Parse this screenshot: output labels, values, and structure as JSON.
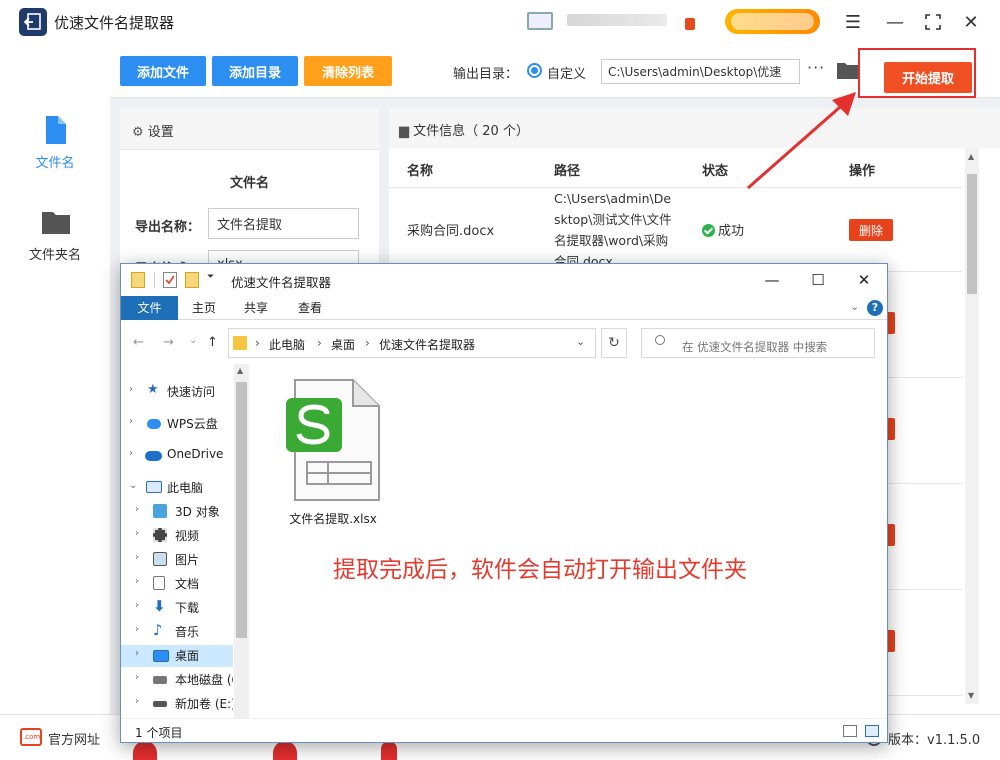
{
  "app": {
    "title": "优速文件名提取器",
    "menu_icon": "hamburger-icon",
    "minimize_icon": "minimize-icon",
    "maximize_icon": "maximize-icon",
    "close_icon": "close-icon"
  },
  "leftnav": {
    "items": [
      {
        "label": "文件名",
        "icon": "file-icon",
        "active": true
      },
      {
        "label": "文件夹名",
        "icon": "folder-icon",
        "active": false
      }
    ]
  },
  "toolbar": {
    "add_file": "添加文件",
    "add_dir": "添加目录",
    "clear_list": "清除列表",
    "output_label": "输出目录：",
    "custom_option": "自定义",
    "output_path": "C:\\Users\\admin\\Desktop\\优速",
    "more": "···",
    "start": "开始提取"
  },
  "settings": {
    "header": "设置",
    "section": "文件名",
    "export_name_label": "导出名称：",
    "export_name_value": "文件名提取",
    "export_format_label": "导出格式：",
    "export_format_value": "xlsx"
  },
  "fileinfo": {
    "header": "文件信息（ 20 个）",
    "columns": [
      "名称",
      "路径",
      "状态",
      "操作"
    ],
    "rows": [
      {
        "name": "采购合同.docx",
        "path": "C:\\Users\\admin\\Desktop\\测试文件\\文件名提取器\\word\\采购合同.docx",
        "status": "成功",
        "action": "删除"
      }
    ]
  },
  "bottombar": {
    "website": "官方网址",
    "website_icon_text": ".com",
    "version": "版本：v1.1.5.0"
  },
  "explorer": {
    "title": "优速文件名提取器",
    "ribbon_tabs": [
      "文件",
      "主页",
      "共享",
      "查看"
    ],
    "breadcrumb": [
      "此电脑",
      "桌面",
      "优速文件名提取器"
    ],
    "search_placeholder": "在 优速文件名提取器 中搜索",
    "tree": [
      {
        "label": "快速访问",
        "icon": "star-icon",
        "level": 0,
        "expander": "›"
      },
      {
        "label": "WPS云盘",
        "icon": "cloud-icon",
        "level": 0,
        "expander": "›"
      },
      {
        "label": "OneDrive",
        "icon": "onedrive-icon",
        "level": 0,
        "expander": "›"
      },
      {
        "label": "此电脑",
        "icon": "pc-icon",
        "level": 0,
        "expander": "⌄"
      },
      {
        "label": "3D 对象",
        "icon": "cube-icon",
        "level": 1,
        "expander": "›"
      },
      {
        "label": "视频",
        "icon": "video-icon",
        "level": 1,
        "expander": "›"
      },
      {
        "label": "图片",
        "icon": "picture-icon",
        "level": 1,
        "expander": "›"
      },
      {
        "label": "文档",
        "icon": "document-icon",
        "level": 1,
        "expander": "›"
      },
      {
        "label": "下载",
        "icon": "download-icon",
        "level": 1,
        "expander": "›"
      },
      {
        "label": "音乐",
        "icon": "music-icon",
        "level": 1,
        "expander": "›"
      },
      {
        "label": "桌面",
        "icon": "desktop-icon",
        "level": 1,
        "expander": "›",
        "selected": true
      },
      {
        "label": "本地磁盘 (C",
        "icon": "disk-icon",
        "level": 1,
        "expander": "›"
      },
      {
        "label": "新加卷 (E:)",
        "icon": "drive-icon",
        "level": 1,
        "expander": "›"
      }
    ],
    "file": {
      "name": "文件名提取.xlsx",
      "icon": "wps-spreadsheet-icon"
    },
    "annotation": "提取完成后，软件会自动打开输出文件夹",
    "status": "1 个项目"
  },
  "colors": {
    "primary_blue": "#2b8ef0",
    "orange": "#ff9f1a",
    "start_red": "#f04e23",
    "delete_red": "#e8421c",
    "annotation_red": "#e53b2f",
    "success_green": "#2bb24c",
    "wps_green": "#3aaa35"
  }
}
